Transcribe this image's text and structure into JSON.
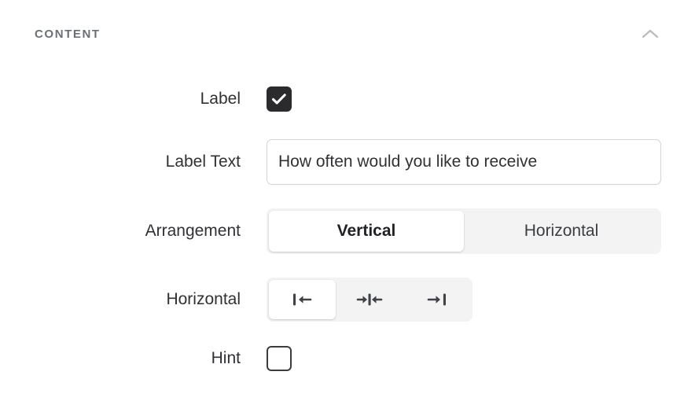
{
  "section": {
    "title": "CONTENT",
    "collapse_icon": "chevron-up-icon"
  },
  "rows": {
    "label": {
      "label": "Label",
      "checked": true,
      "checkbox_icon": "check-icon"
    },
    "label_text": {
      "label": "Label Text",
      "value": "How often would you like to receive ",
      "placeholder": "Label Text"
    },
    "arrangement": {
      "label": "Arrangement",
      "options": [
        {
          "label": "Vertical",
          "active": true
        },
        {
          "label": "Horizontal",
          "active": false
        }
      ]
    },
    "horizontal": {
      "label": "Horizontal",
      "options": [
        {
          "icon": "align-left-icon",
          "active": true
        },
        {
          "icon": "align-center-icon",
          "active": false
        },
        {
          "icon": "align-right-icon",
          "active": false
        }
      ]
    },
    "hint": {
      "label": "Hint",
      "checked": false
    }
  },
  "colors": {
    "checkbox_checked": "#2b2b2e",
    "segment_track": "#f3f3f4",
    "section_title": "#6b7076",
    "text": "#2f3134",
    "input_border": "#d3d4d6"
  }
}
